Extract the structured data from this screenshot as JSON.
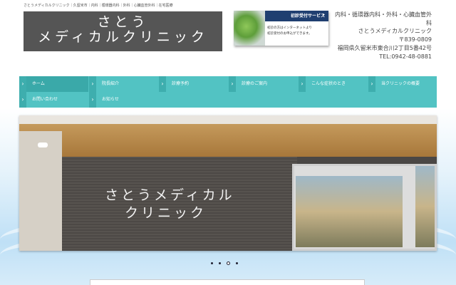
{
  "header": {
    "tagline": "さとうメディカルクリニック｜久留米市｜内科｜循環器内科｜外科｜心臓血管外科｜在宅医療",
    "logo_line1": "さとう",
    "logo_line2": "メディカルクリニック"
  },
  "banner": {
    "title": "初診受付サービス",
    "arrow": "▸",
    "line1": "初診の方はインターネットより",
    "line2": "初診受付のお申込ができます。"
  },
  "info": {
    "departments": "内科・循環器内科・外科・心臓血管外科",
    "clinic_name": "さとうメディカルクリニック",
    "postal": "〒839-0809",
    "address": "福岡県久留米市東合川2丁目5番42号",
    "tel": "TEL:0942-48-0881"
  },
  "nav": {
    "items": [
      {
        "label": "ホーム"
      },
      {
        "label": "院長紹介"
      },
      {
        "label": "診療予約"
      },
      {
        "label": "診療のご案内"
      },
      {
        "label": "こんな症状のとき"
      },
      {
        "label": "当クリニックの概要"
      },
      {
        "label": "お問い合わせ"
      },
      {
        "label": "お知らせ"
      }
    ]
  },
  "slider": {
    "sign_line1": "さとうメディカル",
    "sign_line2": "クリニック",
    "slide_count": 4,
    "active_slide": 3
  },
  "colors": {
    "nav": "#52c3c3",
    "banner_head": "#1f3f70",
    "logo_bg": "#555555"
  }
}
